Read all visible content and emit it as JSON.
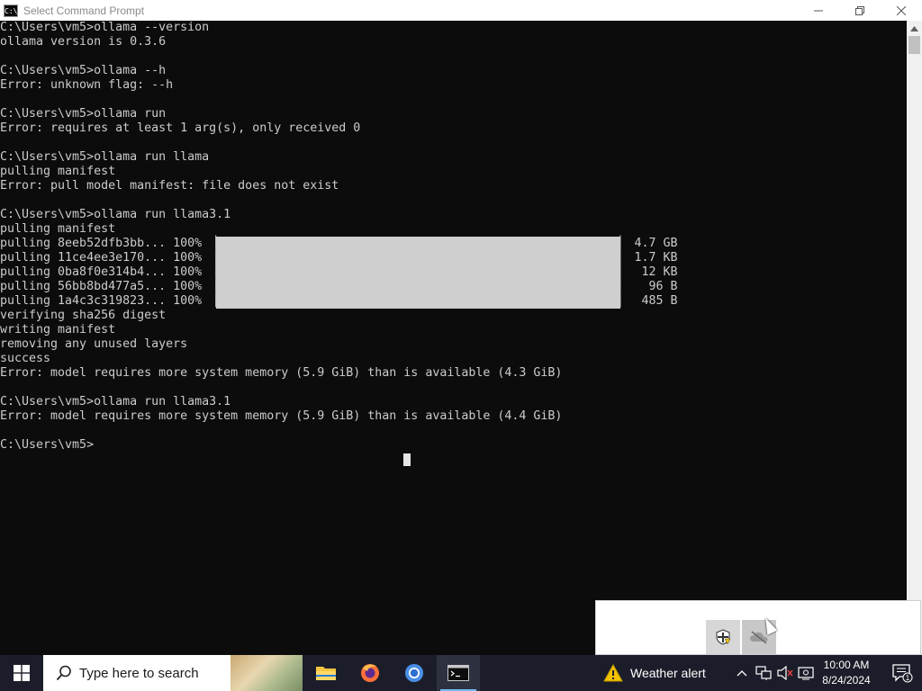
{
  "window": {
    "title": "Select Command Prompt",
    "icon_text": "C:\\"
  },
  "console": {
    "lines": [
      "C:\\Users\\vm5>ollama --version",
      "ollama version is 0.3.6",
      "",
      "C:\\Users\\vm5>ollama --h",
      "Error: unknown flag: --h",
      "",
      "C:\\Users\\vm5>ollama run",
      "Error: requires at least 1 arg(s), only received 0",
      "",
      "C:\\Users\\vm5>ollama run llama",
      "pulling manifest",
      "Error: pull model manifest: file does not exist",
      "",
      "C:\\Users\\vm5>ollama run llama3.1",
      "pulling manifest",
      "pulling 8eeb52dfb3bb... 100% ▕                                                        ▏ 4.7 GB",
      "pulling 11ce4ee3e170... 100% ▕                                                        ▏ 1.7 KB",
      "pulling 0ba8f0e314b4... 100% ▕                                                        ▏  12 KB",
      "pulling 56bb8bd477a5... 100% ▕                                                        ▏   96 B",
      "pulling 1a4c3c319823... 100% ▕                                                        ▏  485 B",
      "verifying sha256 digest",
      "writing manifest",
      "removing any unused layers",
      "success",
      "Error: model requires more system memory (5.9 GiB) than is available (4.3 GiB)",
      "",
      "C:\\Users\\vm5>ollama run llama3.1",
      "Error: model requires more system memory (5.9 GiB) than is available (4.4 GiB)",
      "",
      "C:\\Users\\vm5>"
    ]
  },
  "taskbar": {
    "search_placeholder": "Type here to search",
    "apps": [
      "file-explorer",
      "firefox",
      "chromium",
      "command-prompt"
    ],
    "weather_label": "Weather alert",
    "time": "10:00 AM",
    "date": "8/24/2024",
    "notification_count": "1"
  },
  "colors": {
    "console_bg": "#0c0c0c",
    "console_text": "#cccccc",
    "taskbar_bg": "#1b1e2a",
    "accent": "#76b9ed"
  }
}
